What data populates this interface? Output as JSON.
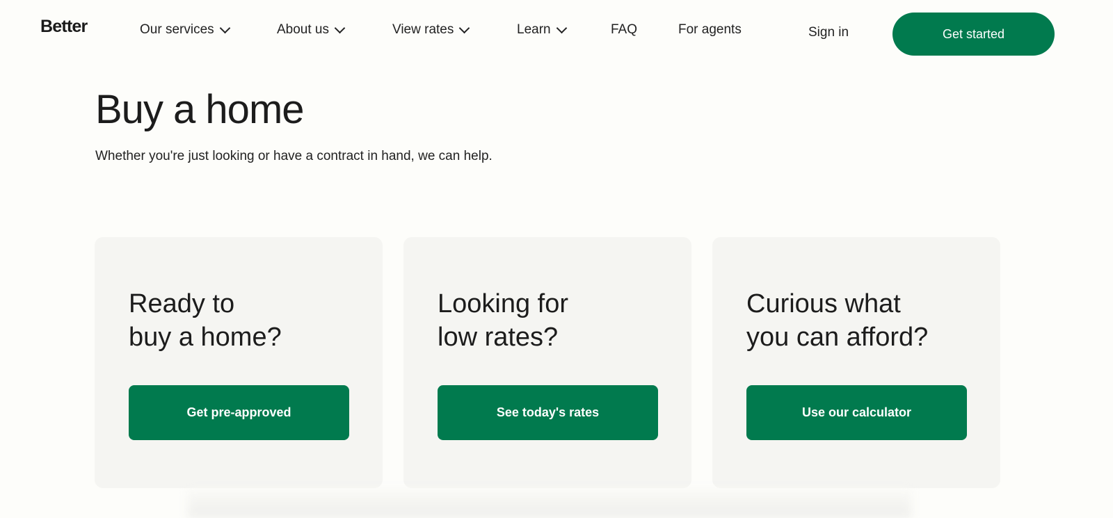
{
  "nav": {
    "logo": "Better",
    "items": [
      {
        "label": "Our services",
        "dropdown": true
      },
      {
        "label": "About us",
        "dropdown": true
      },
      {
        "label": "View rates",
        "dropdown": true
      },
      {
        "label": "Learn",
        "dropdown": true
      },
      {
        "label": "FAQ",
        "dropdown": false
      },
      {
        "label": "For agents",
        "dropdown": false
      }
    ],
    "sign_in": "Sign in",
    "get_started": "Get started"
  },
  "hero": {
    "title": "Buy a home",
    "subtitle": "Whether you're just looking or have a contract in hand, we can help."
  },
  "cards": [
    {
      "title": "Ready to\nbuy a home?",
      "button": "Get pre-approved"
    },
    {
      "title": "Looking for\nlow rates?",
      "button": "See today's rates"
    },
    {
      "title": "Curious what\nyou can afford?",
      "button": "Use our calculator"
    }
  ],
  "colors": {
    "accent": "#017a4e",
    "background": "#fdfdfa",
    "card": "#f5f5f2"
  }
}
